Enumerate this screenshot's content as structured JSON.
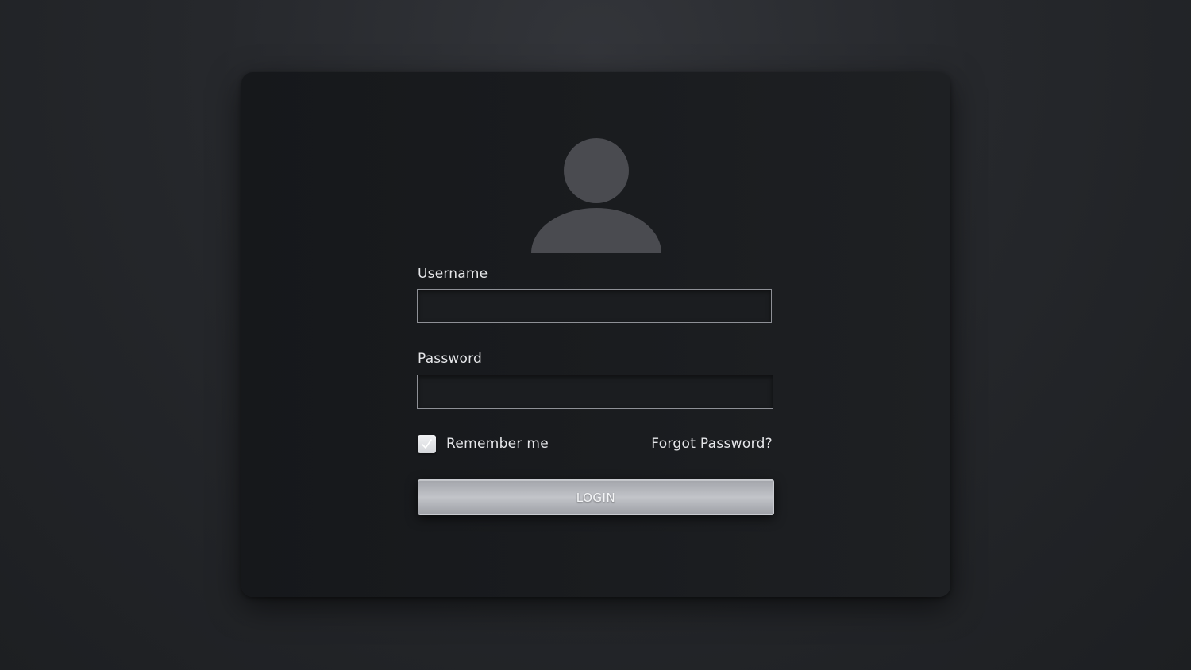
{
  "form": {
    "username_label": "Username",
    "username_value": "",
    "password_label": "Password",
    "password_value": "",
    "remember_label": "Remember me",
    "remember_checked": true,
    "forgot_label": "Forgot Password?",
    "login_label": "LOGIN"
  },
  "icons": {
    "avatar": "user-silhouette-icon",
    "checkbox": "checkmark-icon"
  },
  "colors": {
    "background": "#26282c",
    "card": "#1a1c1f",
    "avatar": "#4a4b50",
    "text": "#e6e7ea",
    "field_border": "#8e9096",
    "button": "#b4b6bb"
  }
}
